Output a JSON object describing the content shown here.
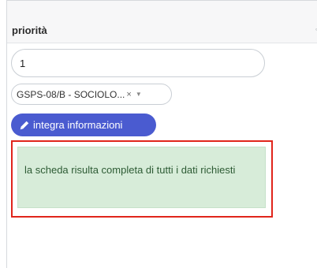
{
  "panel": {
    "title": "priorità",
    "header_glyph": "◦"
  },
  "priority_field": {
    "value": "1"
  },
  "select": {
    "selected_value": "GSPS-08/B - SOCIOLO...",
    "clear_glyph": "×",
    "caret_glyph": "▼"
  },
  "integra_button": {
    "label": "integra informazioni",
    "icon": "pencil-icon"
  },
  "alert": {
    "message": "la scheda risulta completa di tutti i dati richiesti"
  },
  "colors": {
    "button_bg": "#4a5bd0",
    "alert_bg": "#d7ecd9",
    "highlight_border": "#e0251b"
  }
}
